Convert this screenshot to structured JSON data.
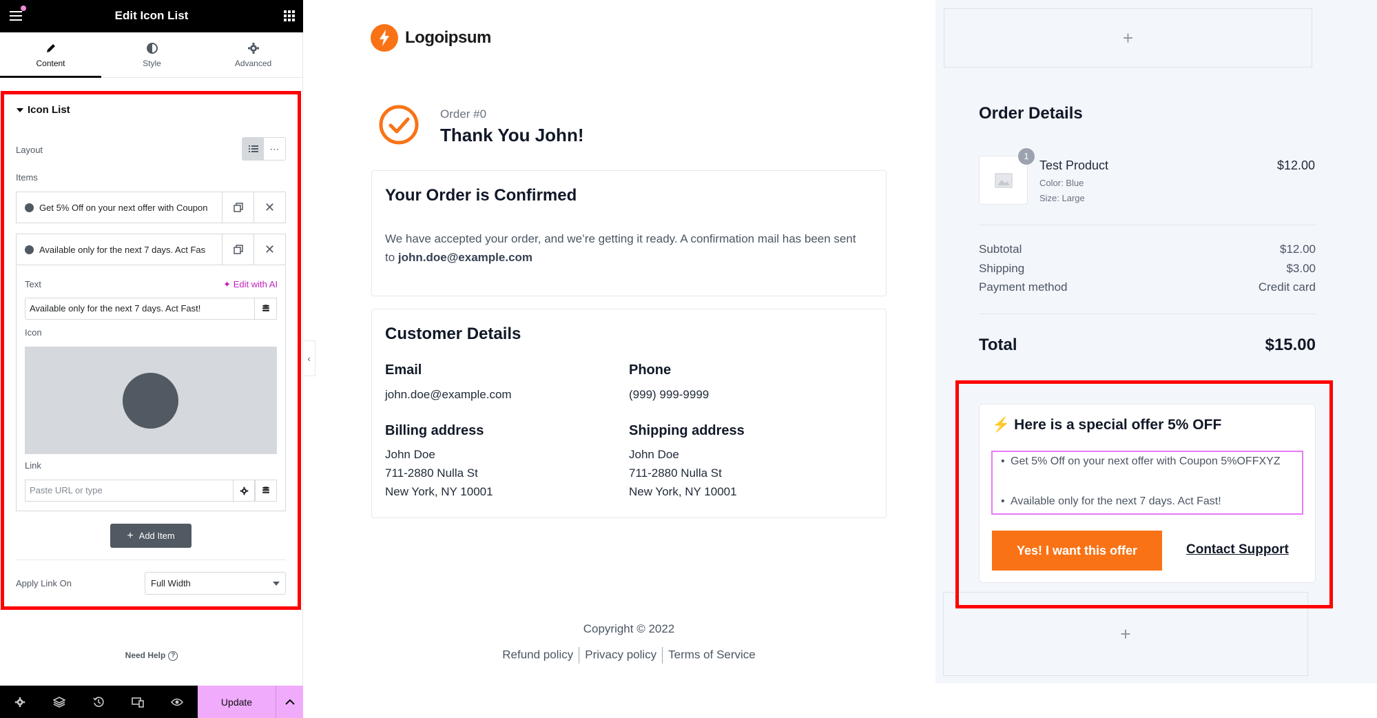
{
  "editor": {
    "title": "Edit Icon List",
    "tabs": [
      {
        "label": "Content",
        "icon": "pencil-icon"
      },
      {
        "label": "Style",
        "icon": "half-circle-icon"
      },
      {
        "label": "Advanced",
        "icon": "gear-icon"
      }
    ],
    "section_title": "Icon List",
    "layout_label": "Layout",
    "items_label": "Items",
    "items": [
      {
        "text": "Get 5% Off on your next offer with Coupon"
      },
      {
        "text": "Available only for the next 7 days. Act Fas"
      }
    ],
    "text_label": "Text",
    "edit_ai_label": "Edit with AI",
    "text_value": "Available only for the next 7 days. Act Fast!",
    "icon_label": "Icon",
    "link_label": "Link",
    "link_placeholder": "Paste URL or type",
    "add_item_label": "Add Item",
    "apply_link_label": "Apply Link On",
    "apply_link_value": "Full Width",
    "need_help": "Need Help",
    "update_label": "Update",
    "accent": "#f0abfc",
    "highlight": "#ff0000"
  },
  "preview": {
    "logo_text": "Logoipsum",
    "order_number": "Order #0",
    "thank_you": "Thank You John!",
    "confirmed_title": "Your Order is Confirmed",
    "confirmed_text": "We have accepted your order, and we’re getting it ready. A confirmation mail has been sent to ",
    "confirmed_email": "john.doe@example.com",
    "customer_title": "Customer Details",
    "email_label": "Email",
    "email_value": "john.doe@example.com",
    "phone_label": "Phone",
    "phone_value": "(999) 999-9999",
    "billing_label": "Billing address",
    "billing_lines": [
      "John Doe",
      "711-2880 Nulla St",
      "New York, NY 10001"
    ],
    "shipping_label": "Shipping address",
    "shipping_lines": [
      "John Doe",
      "711-2880 Nulla St",
      "New York, NY 10001"
    ],
    "copyright": "Copyright © 2022",
    "footer_links": [
      "Refund policy",
      "Privacy policy",
      "Terms of Service"
    ],
    "brand_color": "#f97316"
  },
  "summary": {
    "title": "Order Details",
    "product": {
      "qty": "1",
      "name": "Test Product",
      "color": "Color: Blue",
      "size": "Size: Large",
      "price": "$12.00"
    },
    "rows": [
      {
        "label": "Subtotal",
        "value": "$12.00"
      },
      {
        "label": "Shipping",
        "value": "$3.00"
      },
      {
        "label": "Payment method",
        "value": "Credit card"
      }
    ],
    "total_label": "Total",
    "total_value": "$15.00",
    "offer": {
      "bolt": "⚡",
      "title": "Here is a special offer 5% OFF",
      "items": [
        "Get 5% Off on your next offer with Coupon 5%OFFXYZ",
        "Available only for the next 7 days. Act Fast!"
      ],
      "cta": "Yes! I want this offer",
      "support": "Contact Support"
    },
    "add_symbol": "+"
  }
}
